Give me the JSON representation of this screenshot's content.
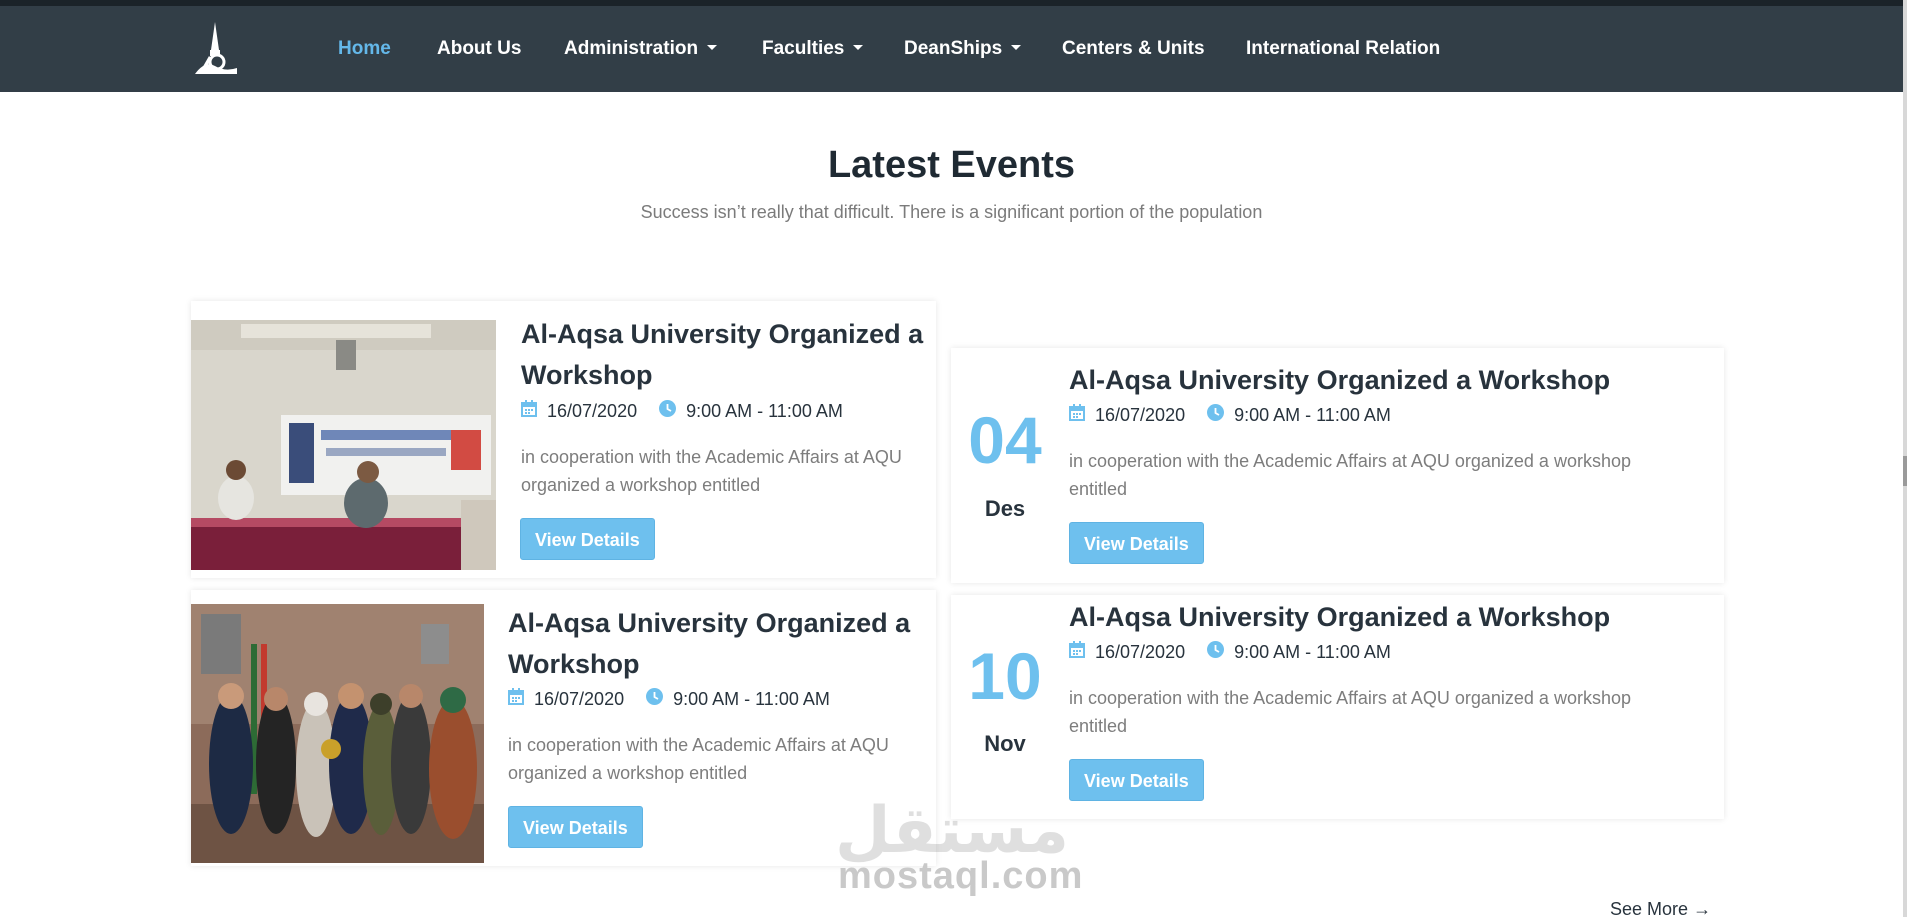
{
  "nav": {
    "items": [
      {
        "label": "Home",
        "active": true
      },
      {
        "label": "About Us"
      },
      {
        "label": "Administration",
        "dropdown": true
      },
      {
        "label": "Faculties",
        "dropdown": true
      },
      {
        "label": "DeanShips",
        "dropdown": true
      },
      {
        "label": "Centers & Units"
      },
      {
        "label": "International Relation"
      }
    ]
  },
  "section": {
    "title": "Latest Events",
    "subtitle": "Success isn’t really that difficult. There is a significant portion of the population"
  },
  "events": [
    {
      "title": "Al-Aqsa University Organized a Workshop",
      "date": "16/07/2020",
      "time": "9:00 AM - 11:00 AM",
      "description": "in cooperation with the Academic Affairs at AQU organized a workshop entitled",
      "button": "View Details",
      "image": "workshop-seminar-photo"
    },
    {
      "title": "Al-Aqsa University Organized a Workshop",
      "date": "16/07/2020",
      "time": "9:00 AM - 11:00 AM",
      "description": "in cooperation with the Academic Affairs at AQU organized a workshop entitled",
      "button": "View Details",
      "image": "group-award-photo"
    },
    {
      "title": "Al-Aqsa University Organized a Workshop",
      "date": "16/07/2020",
      "time": "9:00 AM - 11:00 AM",
      "description": "in cooperation with the Academic Affairs at AQU organized a workshop entitled",
      "button": "View Details",
      "day": "04",
      "month": "Des"
    },
    {
      "title": "Al-Aqsa University Organized a Workshop",
      "date": "16/07/2020",
      "time": "9:00 AM - 11:00 AM",
      "description": "in cooperation with the Academic Affairs at AQU organized a workshop entitled",
      "button": "View Details",
      "day": "10",
      "month": "Nov"
    }
  ],
  "see_more": "See More",
  "watermark": {
    "arabic": "مستقل",
    "latin": "mostaql.com"
  },
  "colors": {
    "navbar": "#323e47",
    "accent": "#6ec0ee",
    "active_link": "#64b8ea"
  }
}
